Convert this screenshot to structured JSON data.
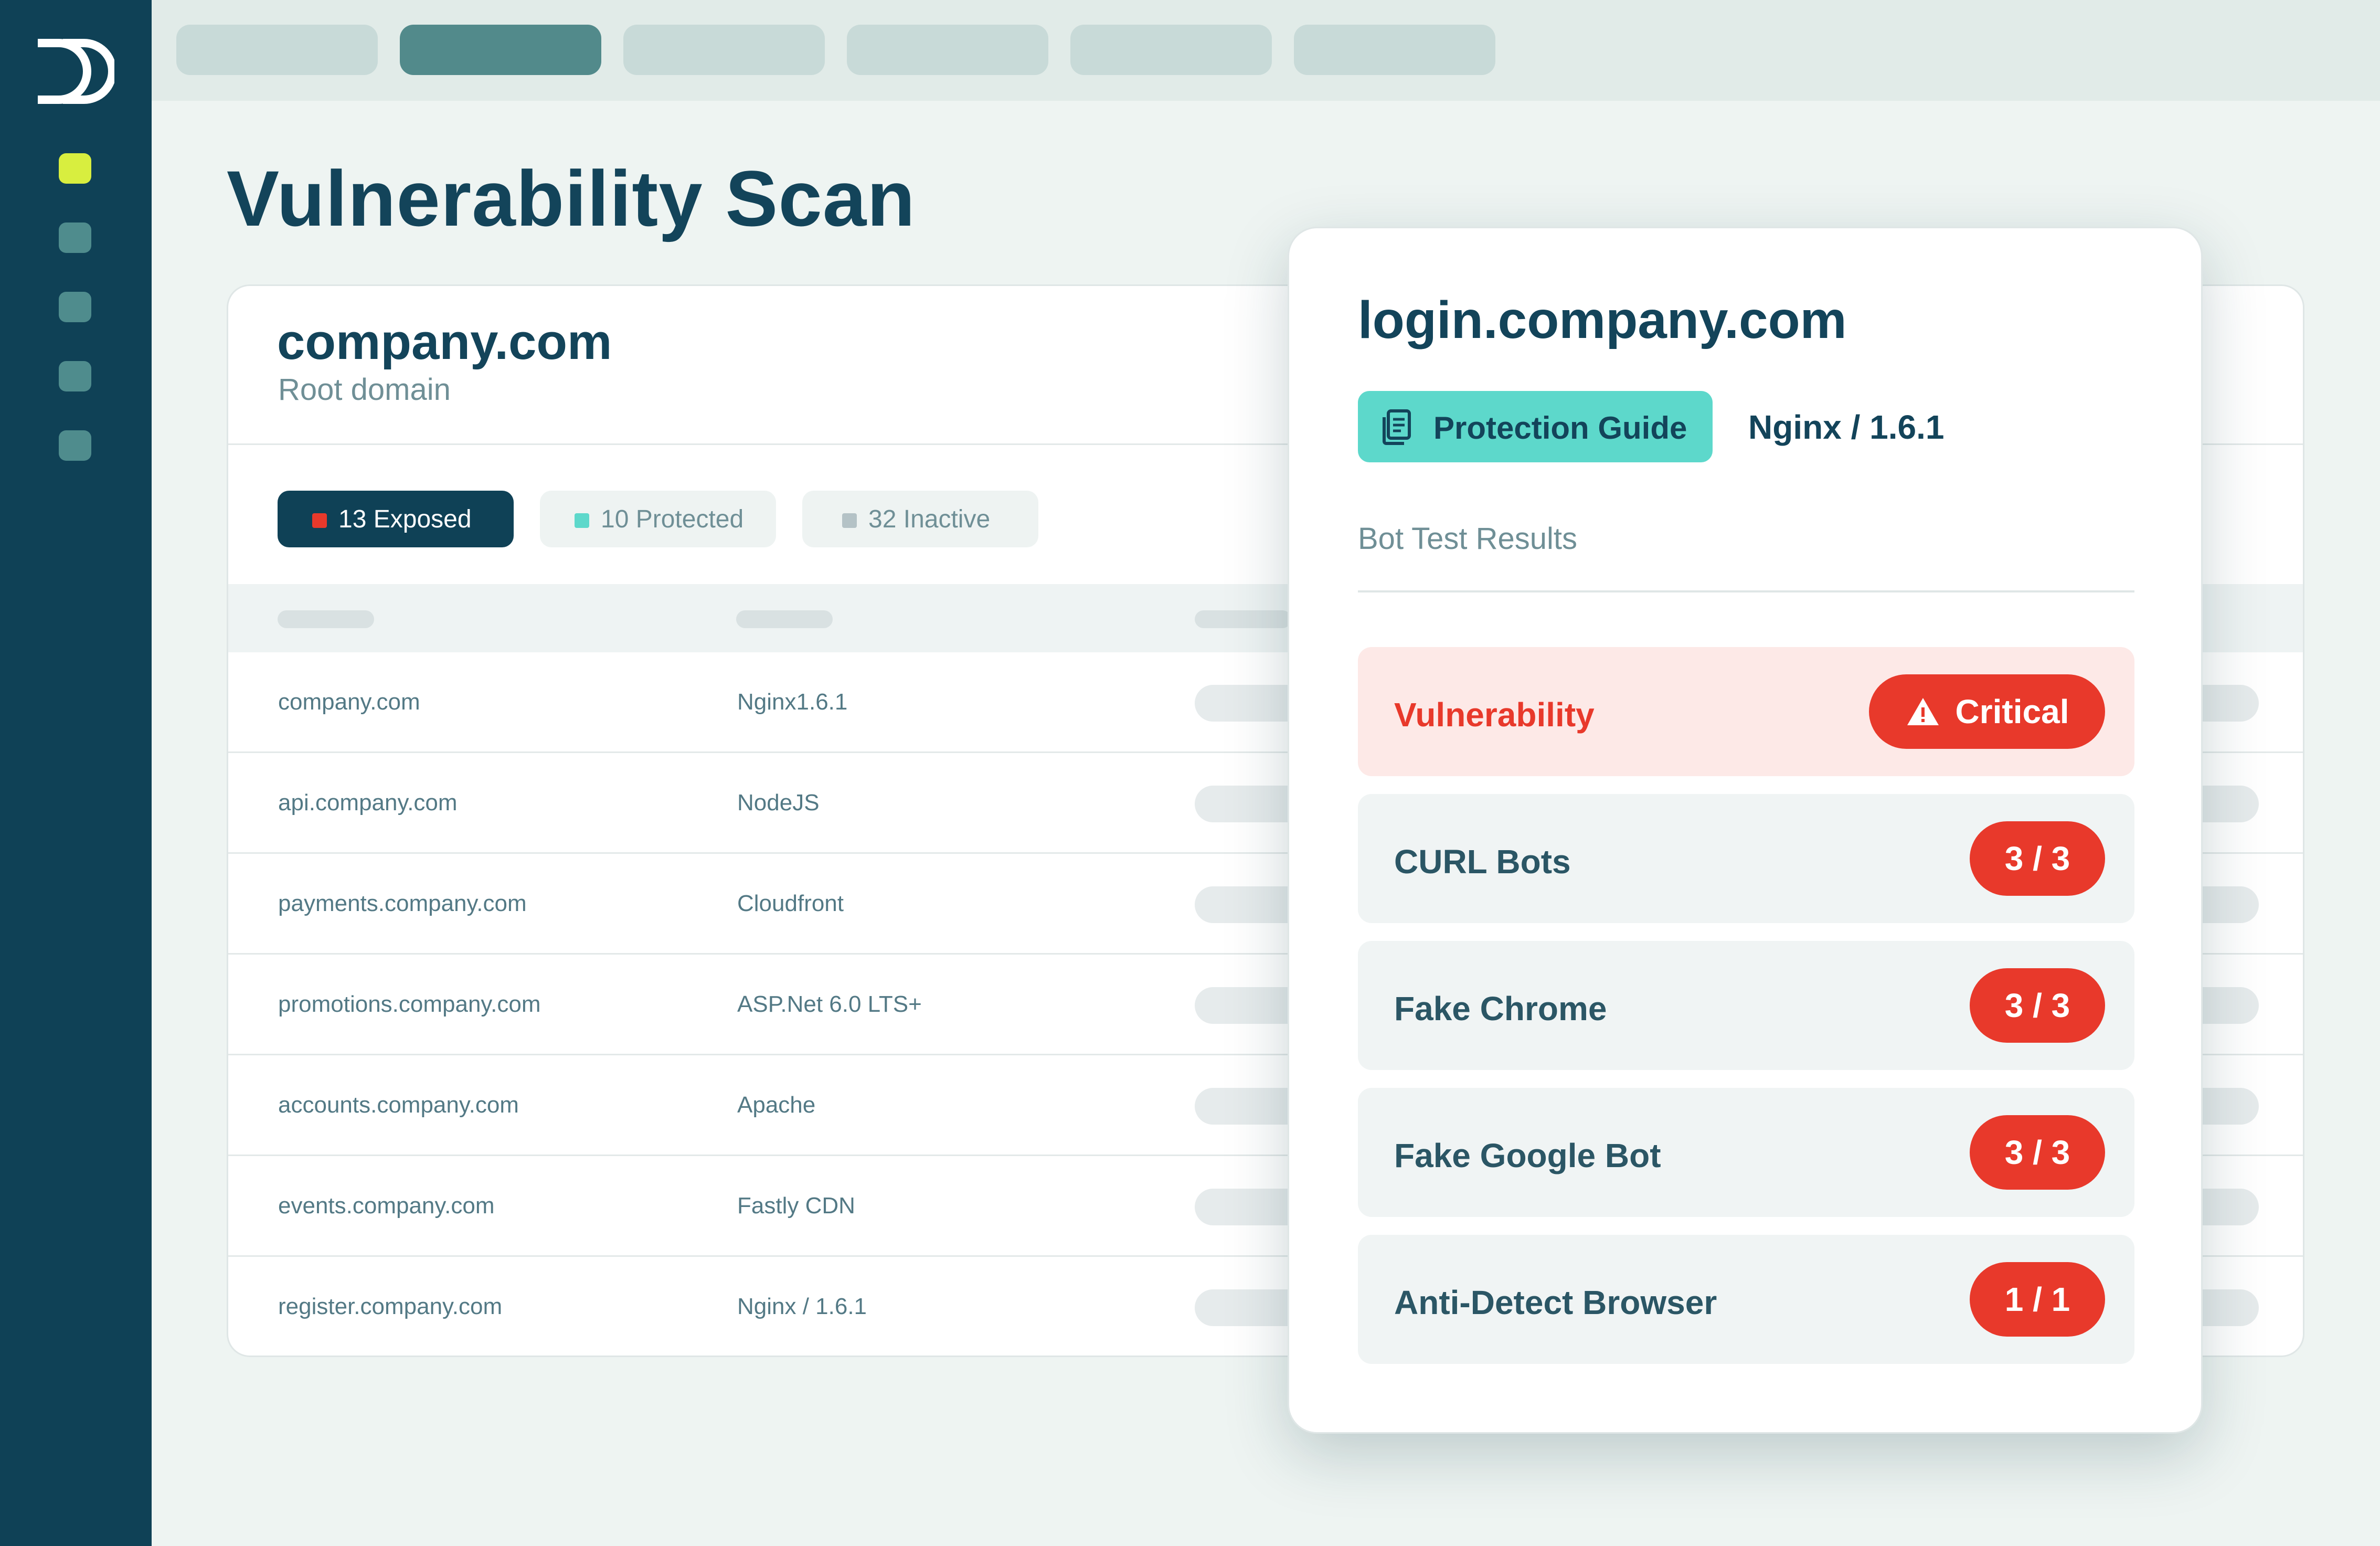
{
  "page": {
    "title": "Vulnerability Scan"
  },
  "colors": {
    "sidebar": "#0f4156",
    "accent_active_dot": "#d8ee3f",
    "tab_active": "#528a8b",
    "teal_button": "#5dd8cb",
    "critical_red": "#e8392b",
    "exposed": "#e8392b",
    "protected": "#5dd8cb",
    "inactive": "#b4c2c6"
  },
  "sidebar": {
    "logo_icon": "datadome-logo-icon",
    "nav_items": 5
  },
  "topbar": {
    "tabs": 6,
    "active_tab_index": 1
  },
  "card": {
    "domain": "company.com",
    "domain_subtitle": "Root domain",
    "filters": [
      {
        "label": "13 Exposed",
        "color": "#e8392b",
        "active": true
      },
      {
        "label": "10 Protected",
        "color": "#5dd8cb",
        "active": false
      },
      {
        "label": "32 Inactive",
        "color": "#b4c2c6",
        "active": false
      }
    ],
    "rows": [
      {
        "host": "company.com",
        "server": "Nginx1.6.1"
      },
      {
        "host": "api.company.com",
        "server": "NodeJS"
      },
      {
        "host": "payments.company.com",
        "server": "Cloudfront"
      },
      {
        "host": "promotions.company.com",
        "server": "ASP.Net 6.0 LTS+"
      },
      {
        "host": "accounts.company.com",
        "server": "Apache"
      },
      {
        "host": "events.company.com",
        "server": "Fastly CDN"
      },
      {
        "host": "register.company.com",
        "server": "Nginx / 1.6.1"
      }
    ]
  },
  "popup": {
    "title": "login.company.com",
    "guide_button": "Protection Guide",
    "guide_icon": "document-icon",
    "server": "Nginx / 1.6.1",
    "section_heading": "Bot Test Results",
    "vulnerability": {
      "label": "Vulnerability",
      "badge": "Critical",
      "badge_icon": "warning-icon"
    },
    "results": [
      {
        "label": "CURL Bots",
        "score": "3 / 3"
      },
      {
        "label": "Fake Chrome",
        "score": "3 / 3"
      },
      {
        "label": "Fake Google Bot",
        "score": "3 / 3"
      },
      {
        "label": "Anti-Detect Browser",
        "score": "1 / 1"
      }
    ]
  }
}
